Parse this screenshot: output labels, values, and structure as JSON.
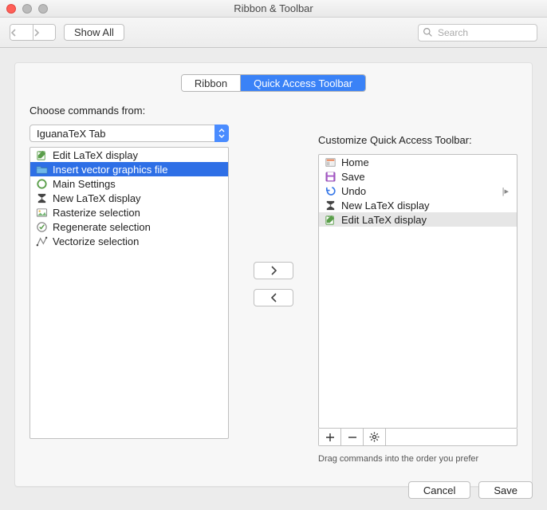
{
  "window_title": "Ribbon & Toolbar",
  "toolbar": {
    "show_all": "Show All",
    "search_placeholder": "Search"
  },
  "tabs": {
    "ribbon": "Ribbon",
    "qat": "Quick Access Toolbar",
    "active": "qat"
  },
  "left": {
    "label": "Choose commands from:",
    "dropdown_value": "IguanaTeX Tab",
    "items": [
      {
        "icon": "edit",
        "label": "Edit LaTeX display",
        "selected": false
      },
      {
        "icon": "folder",
        "label": "Insert vector graphics file",
        "selected": true
      },
      {
        "icon": "circle",
        "label": "Main Settings",
        "selected": false
      },
      {
        "icon": "sigma",
        "label": "New LaTeX display",
        "selected": false
      },
      {
        "icon": "image",
        "label": "Rasterize selection",
        "selected": false
      },
      {
        "icon": "check",
        "label": "Regenerate selection",
        "selected": false
      },
      {
        "icon": "vector",
        "label": "Vectorize selection",
        "selected": false
      }
    ]
  },
  "right": {
    "label": "Customize Quick Access Toolbar:",
    "items": [
      {
        "icon": "home",
        "label": "Home",
        "highlighted": false,
        "submenu": false
      },
      {
        "icon": "save",
        "label": "Save",
        "highlighted": false,
        "submenu": false
      },
      {
        "icon": "undo",
        "label": "Undo",
        "highlighted": false,
        "submenu": true
      },
      {
        "icon": "sigma",
        "label": "New LaTeX display",
        "highlighted": false,
        "submenu": false
      },
      {
        "icon": "edit",
        "label": "Edit LaTeX display",
        "highlighted": true,
        "submenu": false
      }
    ],
    "hint": "Drag commands into the order you prefer"
  },
  "footer": {
    "cancel": "Cancel",
    "save": "Save"
  }
}
